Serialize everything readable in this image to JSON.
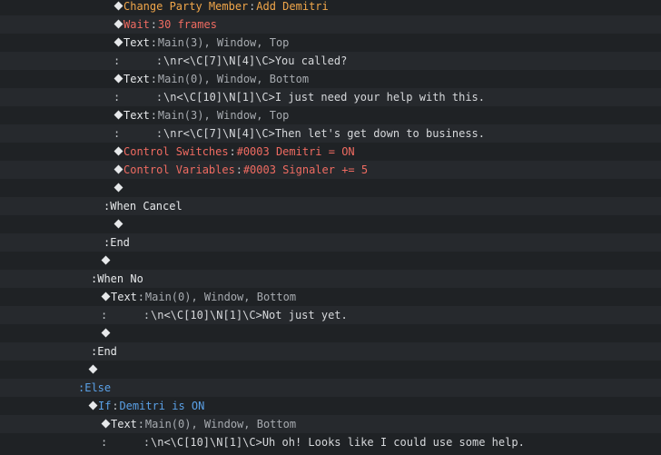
{
  "rows": [
    {
      "indent": 125,
      "kind": "cmd",
      "label": "Change Party Member",
      "sep": ":",
      "value": "Add Demitri",
      "color": "orange"
    },
    {
      "indent": 125,
      "kind": "cmd",
      "label": "Wait",
      "sep": ":",
      "value": "30 frames",
      "color": "red"
    },
    {
      "indent": 125,
      "kind": "cmd",
      "label": "Text",
      "sep": ":",
      "value": "Main(3), Window, Top",
      "color": "white"
    },
    {
      "indent": 125,
      "kind": "cont",
      "colon": ":",
      "value": "\\nr<\\C[7]\\N[4]\\C>You called?"
    },
    {
      "indent": 125,
      "kind": "cmd",
      "label": "Text",
      "sep": ":",
      "value": "Main(0), Window, Bottom",
      "color": "white"
    },
    {
      "indent": 125,
      "kind": "cont",
      "colon": ":",
      "value": "\\n<\\C[10]\\N[1]\\C>I just need your help with this."
    },
    {
      "indent": 125,
      "kind": "cmd",
      "label": "Text",
      "sep": ":",
      "value": "Main(3), Window, Top",
      "color": "white"
    },
    {
      "indent": 125,
      "kind": "cont",
      "colon": ":",
      "value": "\\nr<\\C[7]\\N[4]\\C>Then let's get down to business."
    },
    {
      "indent": 125,
      "kind": "cmd",
      "label": "Control Switches",
      "sep": ":",
      "value": "#0003 Demitri = ON",
      "color": "red"
    },
    {
      "indent": 125,
      "kind": "cmd",
      "label": "Control Variables",
      "sep": ":",
      "value": "#0003 Signaler += 5",
      "color": "red"
    },
    {
      "indent": 125,
      "kind": "empty"
    },
    {
      "indent": 114,
      "kind": "branch",
      "text": ":When Cancel"
    },
    {
      "indent": 125,
      "kind": "empty"
    },
    {
      "indent": 114,
      "kind": "branch",
      "text": ":End"
    },
    {
      "indent": 111,
      "kind": "empty"
    },
    {
      "indent": 100,
      "kind": "branch",
      "text": ":When No"
    },
    {
      "indent": 111,
      "kind": "cmd",
      "label": "Text",
      "sep": ":",
      "value": "Main(0), Window, Bottom",
      "color": "white"
    },
    {
      "indent": 111,
      "kind": "cont",
      "colon": ":",
      "value": "\\n<\\C[10]\\N[1]\\C>Not just yet."
    },
    {
      "indent": 111,
      "kind": "empty"
    },
    {
      "indent": 100,
      "kind": "branch",
      "text": ":End"
    },
    {
      "indent": 97,
      "kind": "empty"
    },
    {
      "indent": 86,
      "kind": "branch",
      "text": ":Else",
      "color": "blue"
    },
    {
      "indent": 97,
      "kind": "cmd",
      "label": "If",
      "sep": ":",
      "value": "Demitri is ON",
      "color": "blue"
    },
    {
      "indent": 111,
      "kind": "cmd",
      "label": "Text",
      "sep": ":",
      "value": "Main(0), Window, Bottom",
      "color": "white"
    },
    {
      "indent": 111,
      "kind": "cont",
      "colon": ":",
      "value": "\\n<\\C[10]\\N[1]\\C>Uh oh! Looks like I could use some help."
    }
  ]
}
